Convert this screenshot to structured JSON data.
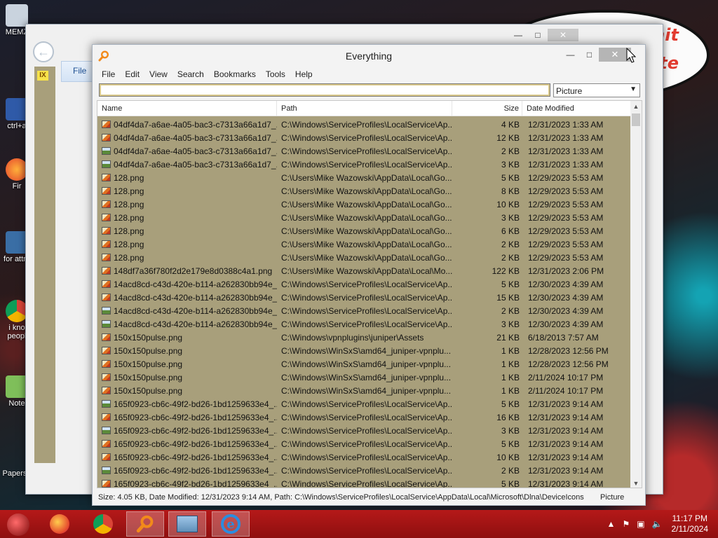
{
  "desktop": {
    "bubble_lines": [
      "to eat shit",
      "orate"
    ],
    "icons": [
      {
        "label": "MEMZ"
      },
      {
        "label": "ctrl+a"
      },
      {
        "label": "Fir"
      },
      {
        "label": "for attra"
      },
      {
        "label": "i kno peopl"
      },
      {
        "label": "Note"
      },
      {
        "label": "Papers, Please Forza Ho Sexe"
      }
    ]
  },
  "explorer": {
    "file_tab": "File",
    "quick_badge": "IX"
  },
  "everything": {
    "title": "Everything",
    "menu": [
      "File",
      "Edit",
      "View",
      "Search",
      "Bookmarks",
      "Tools",
      "Help"
    ],
    "search_value": "",
    "filter_value": "Picture",
    "columns": {
      "name": "Name",
      "path": "Path",
      "size": "Size",
      "date": "Date Modified"
    },
    "rows": [
      {
        "icon": "gif",
        "name": "04df4da7-a6ae-4a05-bac3-c7313a66a1d7_...",
        "path": "C:\\Windows\\ServiceProfiles\\LocalService\\Ap...",
        "size": "4 KB",
        "date": "12/31/2023 1:33 AM"
      },
      {
        "icon": "gif",
        "name": "04df4da7-a6ae-4a05-bac3-c7313a66a1d7_...",
        "path": "C:\\Windows\\ServiceProfiles\\LocalService\\Ap...",
        "size": "12 KB",
        "date": "12/31/2023 1:33 AM"
      },
      {
        "icon": "photo",
        "name": "04df4da7-a6ae-4a05-bac3-c7313a66a1d7_...",
        "path": "C:\\Windows\\ServiceProfiles\\LocalService\\Ap...",
        "size": "2 KB",
        "date": "12/31/2023 1:33 AM"
      },
      {
        "icon": "photo",
        "name": "04df4da7-a6ae-4a05-bac3-c7313a66a1d7_...",
        "path": "C:\\Windows\\ServiceProfiles\\LocalService\\Ap...",
        "size": "3 KB",
        "date": "12/31/2023 1:33 AM"
      },
      {
        "icon": "gif",
        "name": "128.png",
        "path": "C:\\Users\\Mike Wazowski\\AppData\\Local\\Go...",
        "size": "5 KB",
        "date": "12/29/2023 5:53 AM"
      },
      {
        "icon": "gif",
        "name": "128.png",
        "path": "C:\\Users\\Mike Wazowski\\AppData\\Local\\Go...",
        "size": "8 KB",
        "date": "12/29/2023 5:53 AM"
      },
      {
        "icon": "gif",
        "name": "128.png",
        "path": "C:\\Users\\Mike Wazowski\\AppData\\Local\\Go...",
        "size": "10 KB",
        "date": "12/29/2023 5:53 AM"
      },
      {
        "icon": "gif",
        "name": "128.png",
        "path": "C:\\Users\\Mike Wazowski\\AppData\\Local\\Go...",
        "size": "3 KB",
        "date": "12/29/2023 5:53 AM"
      },
      {
        "icon": "gif",
        "name": "128.png",
        "path": "C:\\Users\\Mike Wazowski\\AppData\\Local\\Go...",
        "size": "6 KB",
        "date": "12/29/2023 5:53 AM"
      },
      {
        "icon": "gif",
        "name": "128.png",
        "path": "C:\\Users\\Mike Wazowski\\AppData\\Local\\Go...",
        "size": "2 KB",
        "date": "12/29/2023 5:53 AM"
      },
      {
        "icon": "gif",
        "name": "128.png",
        "path": "C:\\Users\\Mike Wazowski\\AppData\\Local\\Go...",
        "size": "2 KB",
        "date": "12/29/2023 5:53 AM"
      },
      {
        "icon": "gif",
        "name": "148df7a36f780f2d2e179e8d0388c4a1.png",
        "path": "C:\\Users\\Mike Wazowski\\AppData\\Local\\Mo...",
        "size": "122 KB",
        "date": "12/31/2023 2:06 PM"
      },
      {
        "icon": "gif",
        "name": "14acd8cd-c43d-420e-b114-a262830bb94e_...",
        "path": "C:\\Windows\\ServiceProfiles\\LocalService\\Ap...",
        "size": "5 KB",
        "date": "12/30/2023 4:39 AM"
      },
      {
        "icon": "gif",
        "name": "14acd8cd-c43d-420e-b114-a262830bb94e_...",
        "path": "C:\\Windows\\ServiceProfiles\\LocalService\\Ap...",
        "size": "15 KB",
        "date": "12/30/2023 4:39 AM"
      },
      {
        "icon": "photo",
        "name": "14acd8cd-c43d-420e-b114-a262830bb94e_...",
        "path": "C:\\Windows\\ServiceProfiles\\LocalService\\Ap...",
        "size": "2 KB",
        "date": "12/30/2023 4:39 AM"
      },
      {
        "icon": "photo",
        "name": "14acd8cd-c43d-420e-b114-a262830bb94e_...",
        "path": "C:\\Windows\\ServiceProfiles\\LocalService\\Ap...",
        "size": "3 KB",
        "date": "12/30/2023 4:39 AM"
      },
      {
        "icon": "gif",
        "name": "150x150pulse.png",
        "path": "C:\\Windows\\vpnplugins\\juniper\\Assets",
        "size": "21 KB",
        "date": "6/18/2013 7:57 AM"
      },
      {
        "icon": "gif",
        "name": "150x150pulse.png",
        "path": "C:\\Windows\\WinSxS\\amd64_juniper-vpnplu...",
        "size": "1 KB",
        "date": "12/28/2023 12:56 PM"
      },
      {
        "icon": "gif",
        "name": "150x150pulse.png",
        "path": "C:\\Windows\\WinSxS\\amd64_juniper-vpnplu...",
        "size": "1 KB",
        "date": "12/28/2023 12:56 PM"
      },
      {
        "icon": "gif",
        "name": "150x150pulse.png",
        "path": "C:\\Windows\\WinSxS\\amd64_juniper-vpnplu...",
        "size": "1 KB",
        "date": "2/11/2024 10:17 PM"
      },
      {
        "icon": "gif",
        "name": "150x150pulse.png",
        "path": "C:\\Windows\\WinSxS\\amd64_juniper-vpnplu...",
        "size": "1 KB",
        "date": "2/11/2024 10:17 PM"
      },
      {
        "icon": "photo",
        "name": "165f0923-cb6c-49f2-bd26-1bd1259633e4_...",
        "path": "C:\\Windows\\ServiceProfiles\\LocalService\\Ap...",
        "size": "5 KB",
        "date": "12/31/2023 9:14 AM"
      },
      {
        "icon": "gif",
        "name": "165f0923-cb6c-49f2-bd26-1bd1259633e4_...",
        "path": "C:\\Windows\\ServiceProfiles\\LocalService\\Ap...",
        "size": "16 KB",
        "date": "12/31/2023 9:14 AM"
      },
      {
        "icon": "photo",
        "name": "165f0923-cb6c-49f2-bd26-1bd1259633e4_...",
        "path": "C:\\Windows\\ServiceProfiles\\LocalService\\Ap...",
        "size": "3 KB",
        "date": "12/31/2023 9:14 AM"
      },
      {
        "icon": "gif",
        "name": "165f0923-cb6c-49f2-bd26-1bd1259633e4_...",
        "path": "C:\\Windows\\ServiceProfiles\\LocalService\\Ap...",
        "size": "5 KB",
        "date": "12/31/2023 9:14 AM"
      },
      {
        "icon": "gif",
        "name": "165f0923-cb6c-49f2-bd26-1bd1259633e4_...",
        "path": "C:\\Windows\\ServiceProfiles\\LocalService\\Ap...",
        "size": "10 KB",
        "date": "12/31/2023 9:14 AM"
      },
      {
        "icon": "photo",
        "name": "165f0923-cb6c-49f2-bd26-1bd1259633e4_...",
        "path": "C:\\Windows\\ServiceProfiles\\LocalService\\Ap...",
        "size": "2 KB",
        "date": "12/31/2023 9:14 AM"
      },
      {
        "icon": "gif",
        "name": "165f0923-cb6c-49f2-bd26-1bd1259633e4_...",
        "path": "C:\\Windows\\ServiceProfiles\\LocalService\\Ap...",
        "size": "5 KB",
        "date": "12/31/2023 9:14 AM"
      }
    ],
    "status": "Size: 4.05 KB, Date Modified: 12/31/2023 9:14 AM, Path: C:\\Windows\\ServiceProfiles\\LocalService\\AppData\\Local\\Microsoft\\Dlna\\DeviceIcons",
    "status_filter": "Picture"
  },
  "taskbar": {
    "apps": [
      "firefox-icon",
      "chrome-icon",
      "everything-icon",
      "explorer-icon",
      "internet-explorer-icon"
    ],
    "time": "11:17 PM",
    "date": "2/11/2024"
  },
  "colors": {
    "results_bg": "#a89f7b",
    "taskbar": "#b51919",
    "accent_search": "#f28a1a"
  }
}
